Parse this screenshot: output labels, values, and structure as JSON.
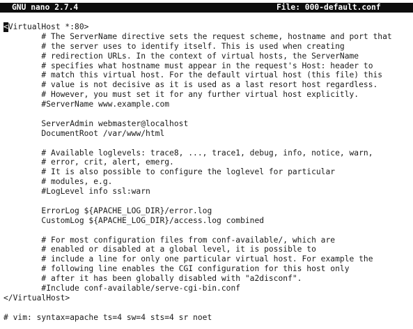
{
  "titlebar": {
    "app": "GNU nano 2.7.4",
    "file": "File: 000-default.conf"
  },
  "editor": {
    "cursor_char": "<",
    "first_line_rest": "VirtualHost *:80>",
    "lines": [
      "        # The ServerName directive sets the request scheme, hostname and port that",
      "        # the server uses to identify itself. This is used when creating",
      "        # redirection URLs. In the context of virtual hosts, the ServerName",
      "        # specifies what hostname must appear in the request's Host: header to",
      "        # match this virtual host. For the default virtual host (this file) this",
      "        # value is not decisive as it is used as a last resort host regardless.",
      "        # However, you must set it for any further virtual host explicitly.",
      "        #ServerName www.example.com",
      "",
      "        ServerAdmin webmaster@localhost",
      "        DocumentRoot /var/www/html",
      "",
      "        # Available loglevels: trace8, ..., trace1, debug, info, notice, warn,",
      "        # error, crit, alert, emerg.",
      "        # It is also possible to configure the loglevel for particular",
      "        # modules, e.g.",
      "        #LogLevel info ssl:warn",
      "",
      "        ErrorLog ${APACHE_LOG_DIR}/error.log",
      "        CustomLog ${APACHE_LOG_DIR}/access.log combined",
      "",
      "        # For most configuration files from conf-available/, which are",
      "        # enabled or disabled at a global level, it is possible to",
      "        # include a line for only one particular virtual host. For example the",
      "        # following line enables the CGI configuration for this host only",
      "        # after it has been globally disabled with \"a2disconf\".",
      "        #Include conf-available/serve-cgi-bin.conf",
      "</VirtualHost>",
      "",
      "# vim: syntax=apache ts=4 sw=4 sts=4 sr noet"
    ]
  }
}
